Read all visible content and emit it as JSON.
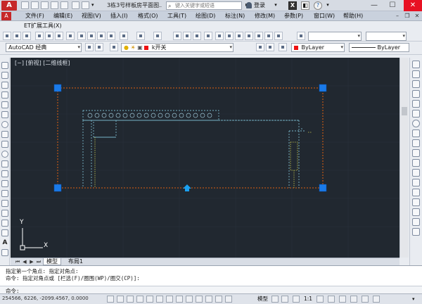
{
  "titlebar": {
    "app_logo": "A",
    "document_title": "3栋3号样板房平面图...",
    "search_placeholder": "键入关键字或短语",
    "login_label": "登录",
    "help_icon": "?"
  },
  "menu": [
    "文件(F)",
    "编辑(E)",
    "视图(V)",
    "插入(I)",
    "格式(O)",
    "工具(T)",
    "绘图(D)",
    "标注(N)",
    "修改(M)",
    "参数(P)",
    "窗口(W)",
    "帮助(H)"
  ],
  "et_tab": "ET扩展工具(X)",
  "workspace": "AutoCAD 经典",
  "layer_name": "k开关",
  "color_value": "ByLayer",
  "linetype_value": "ByLayer",
  "viewport_label": "[−] [俯视] [二维线框]",
  "ucs": {
    "x": "X",
    "y": "Y"
  },
  "tabs": {
    "model": "模型",
    "layout": "布局1"
  },
  "command": {
    "line1": "指定第一个角点: 指定对角点:",
    "line2": "命令: 指定对角点或 [栏选(F)/圈围(WP)/圈交(CP)]:",
    "prompt": "命令:"
  },
  "status": {
    "coords": "254566, 6226, -2099.4567, 0.0000",
    "model": "模型",
    "scale": "1:1"
  },
  "colors": {
    "canvas": "#212830",
    "selection": "#e06010",
    "dashed": "#78b4c8",
    "grip": "#1a7ae8"
  }
}
